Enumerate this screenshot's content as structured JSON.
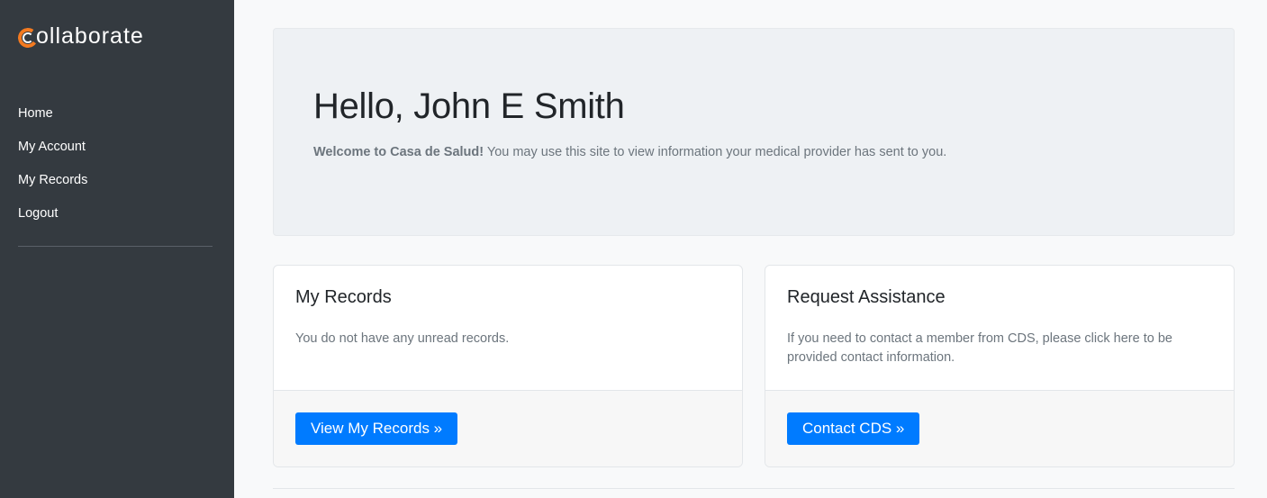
{
  "brand": {
    "name": "ollaborate",
    "logo_letter": "c",
    "accent_color": "#f47a20"
  },
  "sidebar": {
    "items": [
      {
        "label": "Home"
      },
      {
        "label": "My Account"
      },
      {
        "label": "My Records"
      },
      {
        "label": "Logout"
      }
    ]
  },
  "jumbotron": {
    "greeting": "Hello, John E Smith",
    "welcome_bold": "Welcome to Casa de Salud!",
    "welcome_text": " You may use this site to view information your medical provider has sent to you."
  },
  "cards": {
    "records": {
      "title": "My Records",
      "text": "You do not have any unread records.",
      "button": "View My Records »"
    },
    "assistance": {
      "title": "Request Assistance",
      "text": "If you need to contact a member from CDS, please click here to be provided contact information.",
      "button": "Contact CDS »"
    }
  },
  "colors": {
    "sidebar_bg": "#343a40",
    "primary": "#007bff",
    "page_bg": "#f8f9fa"
  }
}
